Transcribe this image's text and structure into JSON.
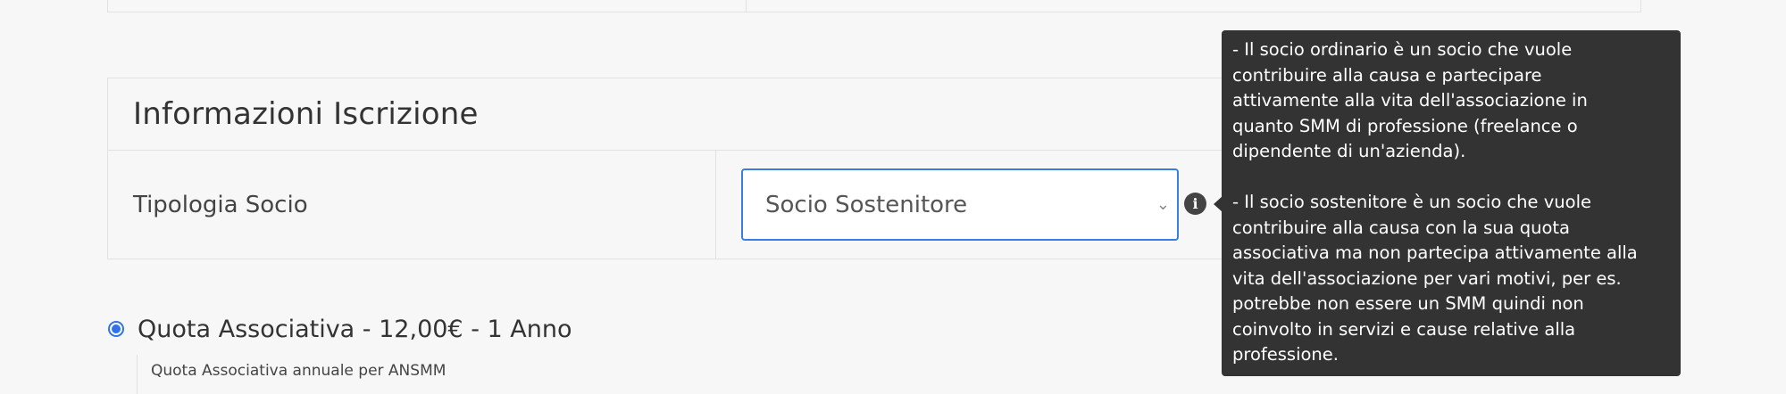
{
  "registration_section": {
    "title": "Informazioni Iscrizione",
    "member_type": {
      "label": "Tipologia Socio",
      "selected_value": "Socio Sostenitore"
    }
  },
  "tooltip": {
    "paragraph_1": "- Il socio ordinario è un socio che vuole\ncontribuire alla causa e partecipare\nattivamente alla vita dell'associazione in\nquanto SMM di professione (freelance o\ndipendente di un'azienda).",
    "paragraph_2": "- Il socio sostenitore è un socio che vuole\ncontribuire alla causa con la sua quota\nassociativa ma non partecipa attivamente alla\nvita dell'associazione per vari motivi, per es.\npotrebbe non essere un SMM quindi non\ncoinvolto in servizi e cause relative alla\nprofessione."
  },
  "membership_fee": {
    "label": "Quota Associativa - 12,00€ -  1 Anno",
    "description": "Quota Associativa annuale per ANSMM",
    "selected": true
  },
  "icons": {
    "info": "info-icon",
    "caret": "chevron-down-icon"
  },
  "colors": {
    "accent": "#3b7ce0",
    "tooltip_bg": "#333333",
    "page_bg": "#f7f7f7"
  }
}
